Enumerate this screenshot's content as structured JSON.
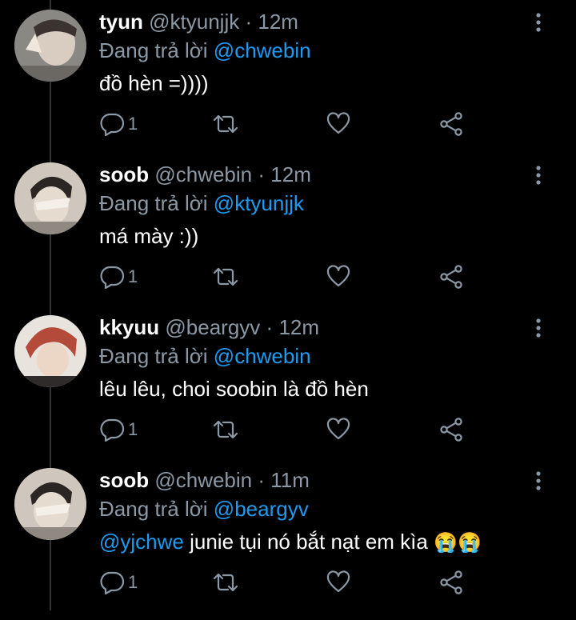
{
  "reply_prefix": "Đang trả lời",
  "colors": {
    "background": "#000000",
    "muted": "#8b98a5",
    "link": "#1d9bf0",
    "thread_line": "#2f3336"
  },
  "icons": {
    "reply": "reply-icon",
    "retweet": "retweet-icon",
    "like": "heart-icon",
    "share": "share-icon",
    "more": "more-vertical-icon"
  },
  "tweets": [
    {
      "name": "tyun",
      "handle": "@ktyunjjk",
      "dot": "·",
      "time": "12m",
      "replying_to": "@chwebin",
      "text_mention": "",
      "text": "đồ hèn =))))",
      "reply_count": "1",
      "emoji": ""
    },
    {
      "name": "soob",
      "handle": "@chwebin",
      "dot": "·",
      "time": "12m",
      "replying_to": "@ktyunjjk",
      "text_mention": "",
      "text": "má mày :))",
      "reply_count": "1",
      "emoji": ""
    },
    {
      "name": "kkyuu",
      "handle": "@beargyv",
      "dot": "·",
      "time": "12m",
      "replying_to": "@chwebin",
      "text_mention": "",
      "text": "lêu lêu, choi soobin là đồ hèn",
      "reply_count": "1",
      "emoji": ""
    },
    {
      "name": "soob",
      "handle": "@chwebin",
      "dot": "·",
      "time": "11m",
      "replying_to": "@beargyv",
      "text_mention": "@yjchwe",
      "text": " junie tụi nó bắt nạt em kìa ",
      "reply_count": "1",
      "emoji": "😭😭"
    }
  ]
}
